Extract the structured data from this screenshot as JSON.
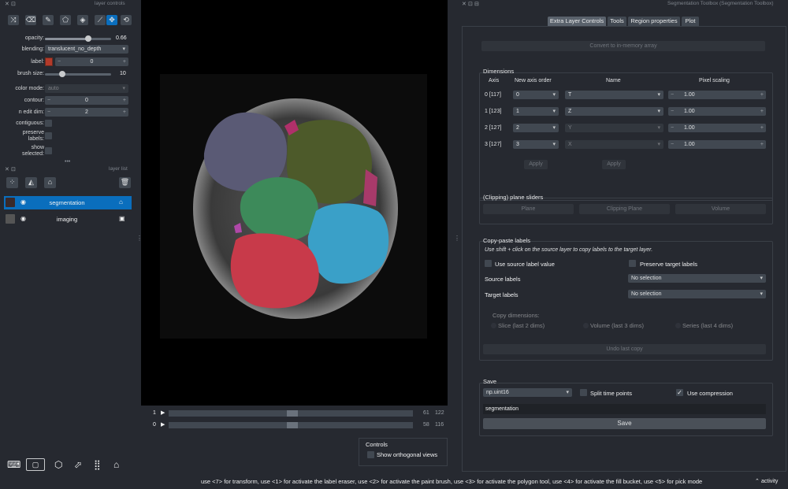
{
  "colors": {
    "bg": "#262930",
    "widget": "#414851",
    "accent": "#0a6ebd",
    "label_swatch": "#b33a2a"
  },
  "left_dock": {
    "layer_controls_title": "layer controls",
    "layer_list_title": "layer list",
    "toolbar_icons": [
      "shuffle-icon",
      "eraser-icon",
      "paint-brush-icon",
      "polygon-icon",
      "fill-bucket-icon",
      "eyedropper-icon",
      "move-icon",
      "transform-icon"
    ],
    "controls": {
      "opacity_label": "opacity:",
      "opacity_value": "0.66",
      "opacity_level": 0.66,
      "blending_label": "blending:",
      "blending_value": "translucent_no_depth",
      "label_label": "label:",
      "label_value": "0",
      "brush_size_label": "brush size:",
      "brush_size_value": "10",
      "color_mode_label": "color mode:",
      "color_mode_value": "auto",
      "contour_label": "contour:",
      "contour_value": "0",
      "n_edit_dim_label": "n edit dim:",
      "n_edit_dim_value": "2",
      "contiguous_label": "contiguous:",
      "preserve_labels_label_1": "preserve",
      "preserve_labels_label_2": "labels:",
      "show_selected_label_1": "show",
      "show_selected_label_2": "selected:"
    },
    "layers": [
      {
        "name": "segmentation",
        "selected": true
      },
      {
        "name": "imaging",
        "selected": false
      }
    ]
  },
  "viewer": {
    "slider1_index": "1",
    "slider1_value": "61",
    "slider1_max": "122",
    "slider2_index": "0",
    "slider2_value": "58",
    "slider2_max": "116",
    "slider1_pos": 0.5,
    "slider2_pos": 0.5
  },
  "controls_widget": {
    "title": "Controls",
    "show_orthogonal": "Show orthogonal views"
  },
  "right_dock": {
    "title": "Segmentation Toolbox (Segmentation Toolbox)",
    "tabs": [
      "Extra Layer Controls",
      "Tools",
      "Region properties",
      "Plot"
    ],
    "convert_btn": "Convert to in-memory array",
    "dimensions": {
      "title": "Dimensions",
      "headers": [
        "Axis",
        "New axis order",
        "Name",
        "Pixel scaling"
      ],
      "rows": [
        {
          "axis": "0 [117]",
          "order": "0",
          "name": "T",
          "scale": "1.00",
          "name_dim": false
        },
        {
          "axis": "1 [123]",
          "order": "1",
          "name": "Z",
          "scale": "1.00",
          "name_dim": false
        },
        {
          "axis": "2 [127]",
          "order": "2",
          "name": "Y",
          "scale": "1.00",
          "name_dim": true
        },
        {
          "axis": "3 [127]",
          "order": "3",
          "name": "X",
          "scale": "1.00",
          "name_dim": true
        }
      ],
      "apply1": "Apply",
      "apply2": "Apply"
    },
    "clipping": {
      "title": "(Clipping) plane sliders",
      "buttons": [
        "Plane",
        "Clipping Plane",
        "Volume"
      ]
    },
    "copy_paste": {
      "title": "Copy-paste labels",
      "hint": "Use shift + click on the source layer to copy labels to the target layer.",
      "use_source": "Use source label value",
      "preserve_target": "Preserve target labels",
      "source_label": "Source labels",
      "source_value": "No selection",
      "target_label": "Target labels",
      "target_value": "No selection",
      "copy_dims": "Copy dimensions:",
      "radios": [
        "Slice (last 2 dims)",
        "Volume (last 3 dims)",
        "Series (last 4 dims)"
      ],
      "undo": "Undo last copy"
    },
    "save": {
      "title": "Save",
      "dtype": "np.uint16",
      "split": "Split time points",
      "compress": "Use compression",
      "filename": "segmentation",
      "save_btn": "Save"
    }
  },
  "bottom_toolbar_icons": [
    "console-icon",
    "ndisplay-icon",
    "roll-dims-icon",
    "transpose-icon",
    "grid-icon",
    "home-icon"
  ],
  "status": {
    "message": "use <7> for transform, use <1> for activate the label eraser, use <2> for activate the paint brush, use <3> for activate the polygon tool, use <4> for activate the fill bucket, use <5> for pick mode",
    "activity": "activity"
  }
}
